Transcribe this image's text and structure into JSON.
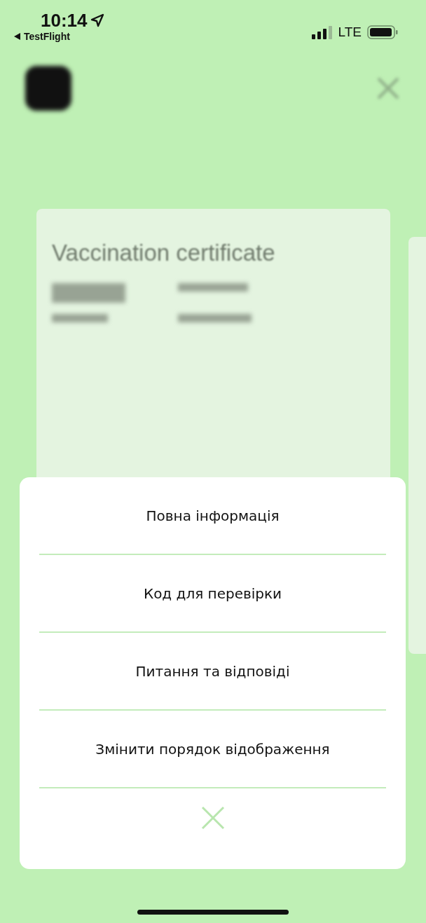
{
  "status_bar": {
    "time": "10:14",
    "back_app": "TestFlight",
    "network": "LTE"
  },
  "card": {
    "title": "Vaccination certificate"
  },
  "action_sheet": {
    "items": [
      {
        "label": "Повна інформація"
      },
      {
        "label": "Код для перевірки"
      },
      {
        "label": "Питання та відповіді"
      },
      {
        "label": "Змінити порядок відображення"
      }
    ]
  }
}
